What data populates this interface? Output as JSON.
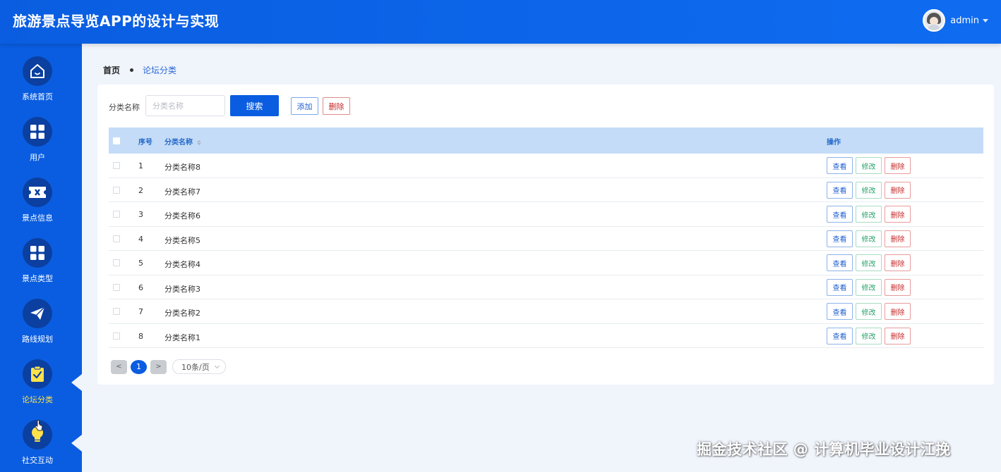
{
  "app": {
    "title": "旅游景点导览APP的设计与实现",
    "username": "admin"
  },
  "sidebar": {
    "items": [
      {
        "label": "系统首页",
        "icon": "home-icon"
      },
      {
        "label": "用户",
        "icon": "grid-icon"
      },
      {
        "label": "景点信息",
        "icon": "ticket-icon"
      },
      {
        "label": "景点类型",
        "icon": "grid-icon"
      },
      {
        "label": "路线规划",
        "icon": "paper-plane-icon"
      },
      {
        "label": "论坛分类",
        "icon": "clipboard-check-icon",
        "active": true
      },
      {
        "label": "社交互动",
        "icon": "lightbulb-icon"
      }
    ]
  },
  "breadcrumb": {
    "home": "首页",
    "current": "论坛分类"
  },
  "search": {
    "label": "分类名称",
    "placeholder": "分类名称",
    "value": "",
    "search_label": "搜索",
    "add_label": "添加",
    "delete_label": "删除"
  },
  "table": {
    "headers": {
      "index": "序号",
      "name": "分类名称",
      "actions": "操作"
    },
    "rows": [
      {
        "index": "1",
        "name": "分类名称8"
      },
      {
        "index": "2",
        "name": "分类名称7"
      },
      {
        "index": "3",
        "name": "分类名称6"
      },
      {
        "index": "4",
        "name": "分类名称5"
      },
      {
        "index": "5",
        "name": "分类名称4"
      },
      {
        "index": "6",
        "name": "分类名称3"
      },
      {
        "index": "7",
        "name": "分类名称2"
      },
      {
        "index": "8",
        "name": "分类名称1"
      }
    ],
    "row_actions": {
      "view": "查看",
      "edit": "修改",
      "delete": "删除"
    }
  },
  "pagination": {
    "prev": "<",
    "current_page": "1",
    "next": ">",
    "page_size": "10条/页"
  },
  "watermark": "掘金技术社区 @ 计算机毕业设计江挽",
  "colors": {
    "primary": "#0a5de0",
    "sidebar_circle": "#0b3fa0",
    "active_label": "#ffe24a",
    "table_header": "#c4dcf7",
    "danger": "#c62828",
    "success": "#27a36a"
  }
}
